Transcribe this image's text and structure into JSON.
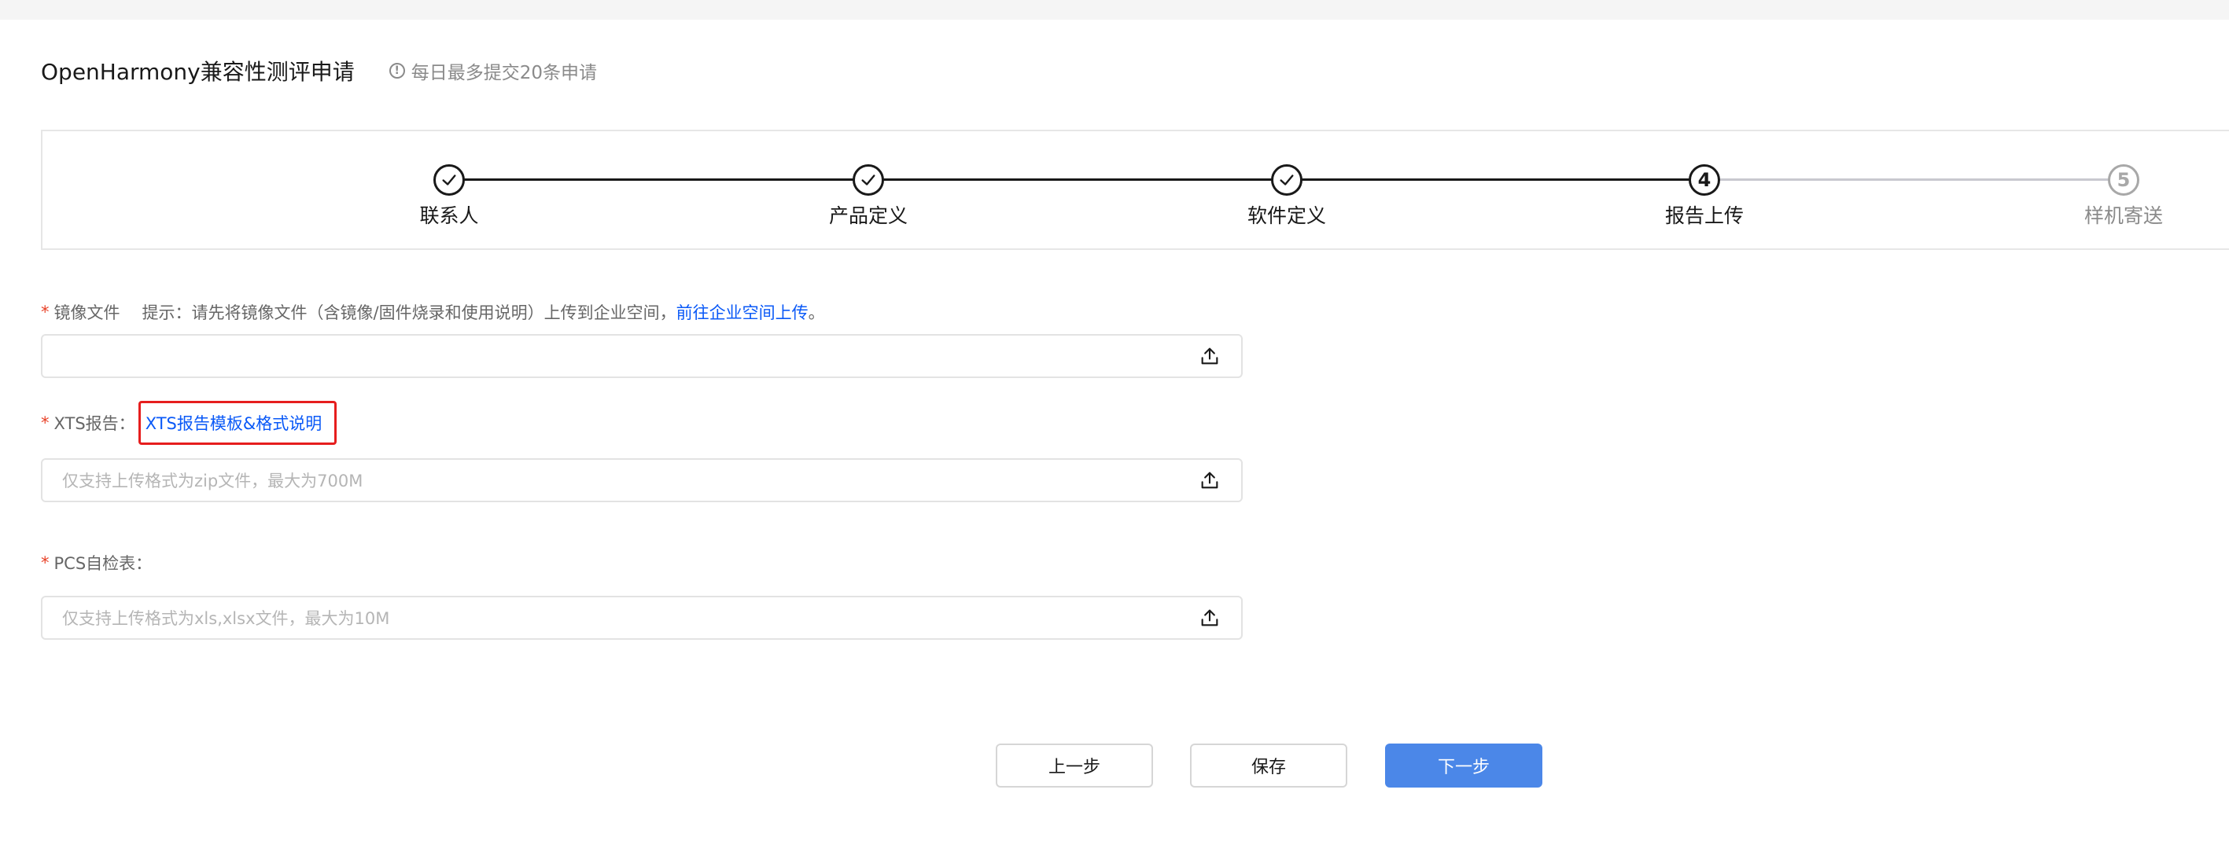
{
  "header": {
    "title": "OpenHarmony兼容性测评申请",
    "tip_icon": "!",
    "tip": "每日最多提交20条申请"
  },
  "steps": [
    {
      "label": "联系人",
      "status": "done"
    },
    {
      "label": "产品定义",
      "status": "done"
    },
    {
      "label": "软件定义",
      "status": "done"
    },
    {
      "label": "报告上传",
      "status": "current",
      "number": "4"
    },
    {
      "label": "样机寄送",
      "status": "todo",
      "number": "5"
    }
  ],
  "form": {
    "image_file": {
      "required_mark": "*",
      "label": "镜像文件",
      "hint": "提示：请先将镜像文件（含镜像/固件烧录和使用说明）上传到企业空间，",
      "link": "前往企业空间上传",
      "suffix": "。",
      "placeholder": ""
    },
    "xts_report": {
      "required_mark": "*",
      "label": "XTS报告：",
      "link": "XTS报告模板&格式说明",
      "placeholder": "仅支持上传格式为zip文件，最大为700M"
    },
    "pcs_form": {
      "required_mark": "*",
      "label": "PCS自检表：",
      "placeholder": "仅支持上传格式为xls,xlsx文件，最大为10M"
    }
  },
  "buttons": {
    "prev": "上一步",
    "save": "保存",
    "next": "下一步"
  },
  "colors": {
    "primary": "#4b87e8",
    "link": "#0a59f7",
    "required": "#e84026",
    "highlight": "#e61e1e"
  }
}
